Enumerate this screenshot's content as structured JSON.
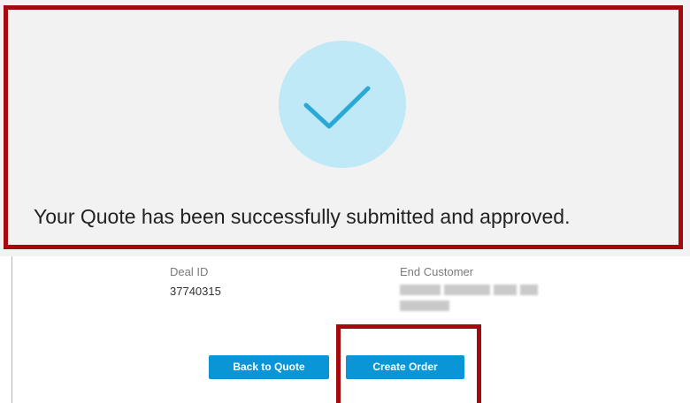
{
  "confirmation": {
    "icon": "checkmark-icon",
    "message": "Your Quote has been successfully submitted and approved."
  },
  "details": {
    "deal_id_label": "Deal ID",
    "deal_id_value": "37740315",
    "end_customer_label": "End Customer"
  },
  "actions": {
    "back_label": "Back to Quote",
    "create_order_label": "Create Order"
  },
  "colors": {
    "highlight": "#a5080d",
    "button": "#0a96d6",
    "circle": "#bfe9f7",
    "check": "#2aa9d6"
  }
}
